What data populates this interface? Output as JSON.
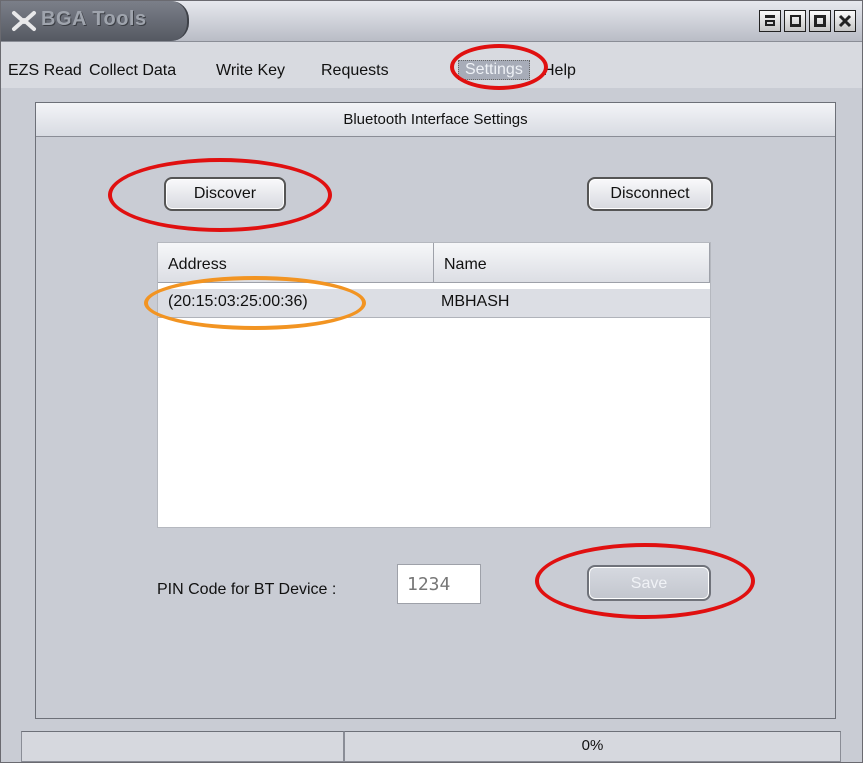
{
  "window": {
    "title": "BGA Tools",
    "buttons": [
      "restore-small-icon",
      "minimize-icon",
      "maximize-icon",
      "close-icon"
    ]
  },
  "menu": {
    "items": [
      {
        "label": "EZS Read"
      },
      {
        "label": "Collect Data"
      },
      {
        "label": "Write Key"
      },
      {
        "label": "Requests"
      },
      {
        "label": "Settings"
      },
      {
        "label": "Help"
      }
    ],
    "selected": "Settings"
  },
  "panel": {
    "title": "Bluetooth Interface  Settings",
    "discover_label": "Discover",
    "disconnect_label": "Disconnect",
    "table": {
      "columns": [
        "Address",
        "Name"
      ],
      "rows": [
        {
          "address": "(20:15:03:25:00:36)",
          "name": "MBHASH"
        }
      ]
    },
    "pin_label": "PIN Code for BT Device :",
    "pin_value": "1234",
    "save_label": "Save"
  },
  "status": {
    "left": "",
    "progress_text": "0%"
  },
  "colors": {
    "highlight_red": "#e01010",
    "highlight_orange": "#f29422",
    "panel_bg": "#c9ccd4"
  }
}
